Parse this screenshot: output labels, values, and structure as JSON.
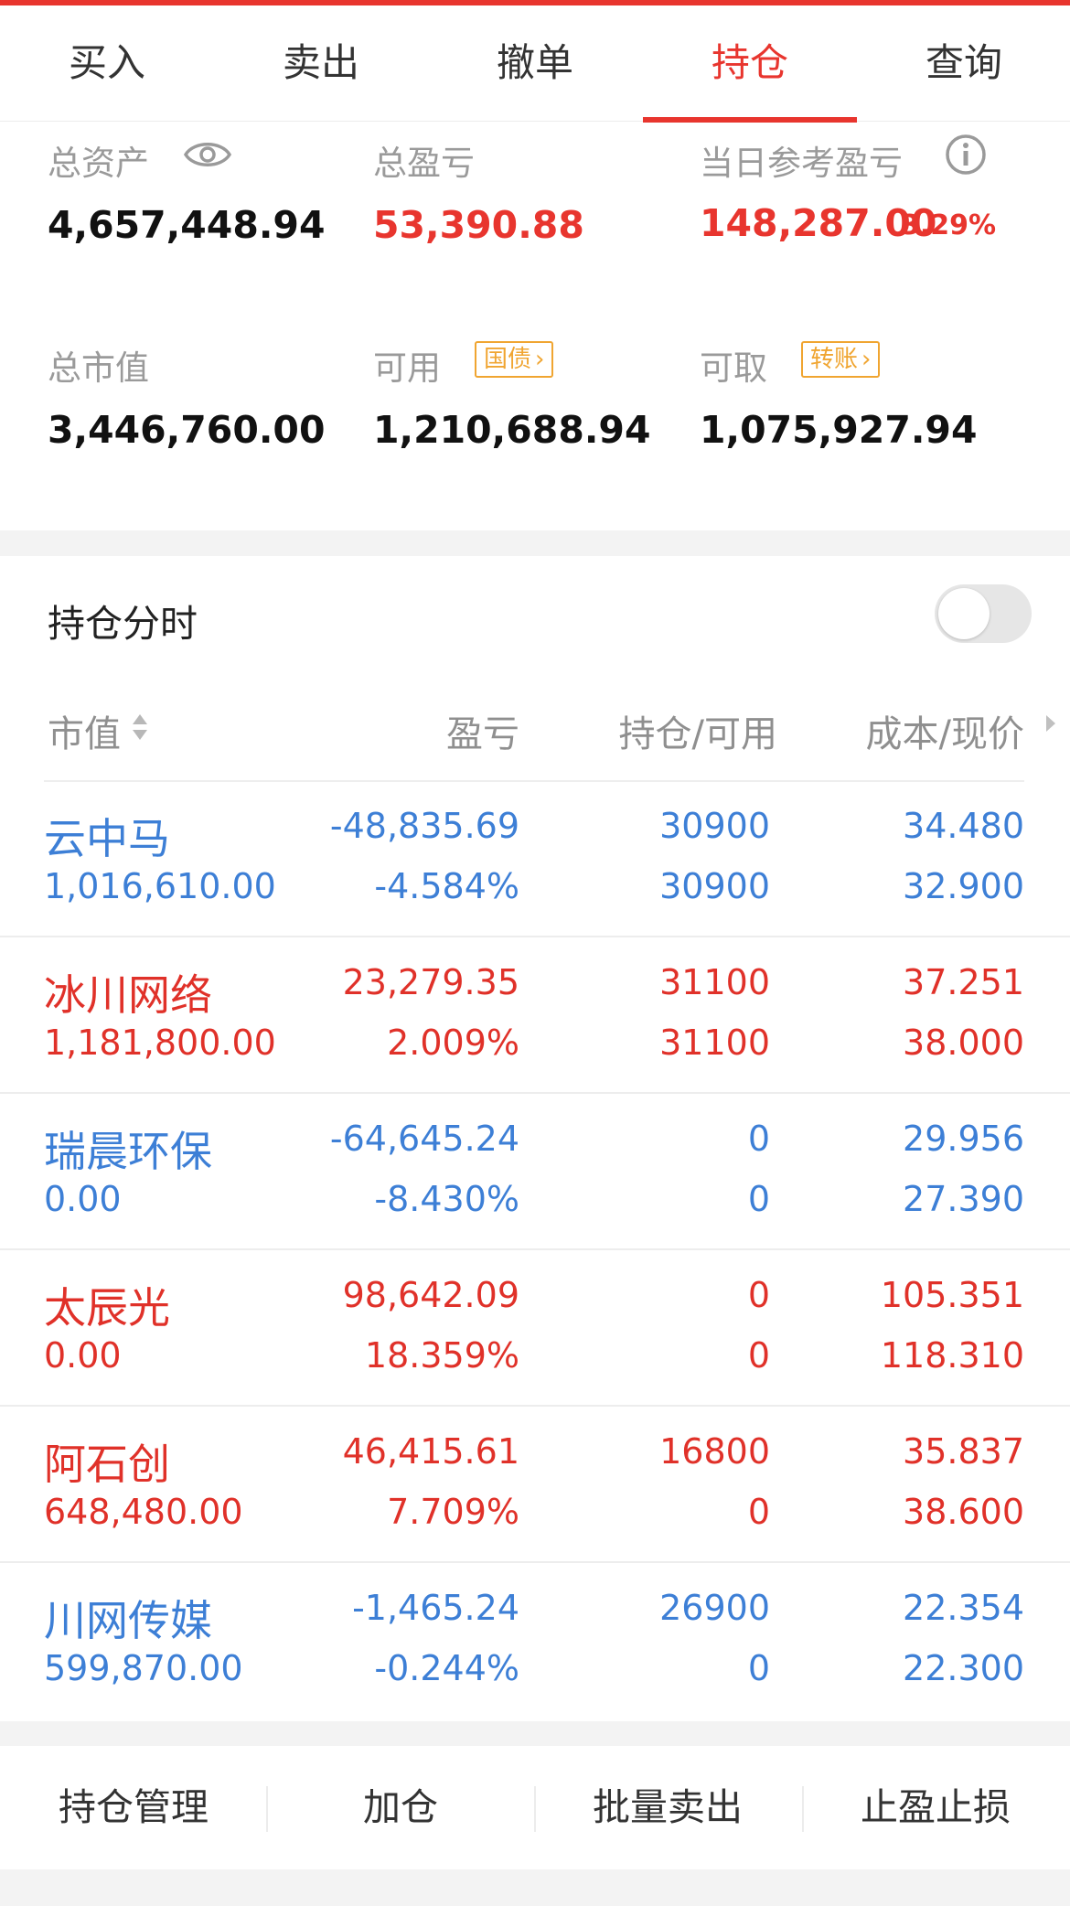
{
  "tabs": [
    {
      "label": "买入"
    },
    {
      "label": "卖出"
    },
    {
      "label": "撤单"
    },
    {
      "label": "持仓"
    },
    {
      "label": "查询"
    }
  ],
  "summary": {
    "total_assets_label": "总资产",
    "total_assets": "4,657,448.94",
    "total_pl_label": "总盈亏",
    "total_pl": "53,390.88",
    "daily_pl_label": "当日参考盈亏",
    "daily_pl": "148,287.00",
    "daily_pl_pct": "3.29%",
    "market_value_label": "总市值",
    "market_value": "3,446,760.00",
    "available_label": "可用",
    "available_tag": "国债",
    "available": "1,210,688.94",
    "withdrawable_label": "可取",
    "withdrawable_tag": "转账",
    "withdrawable": "1,075,927.94"
  },
  "holdings": {
    "title": "持仓分时",
    "toggle_on": false,
    "columns": [
      "市值",
      "盈亏",
      "持仓/可用",
      "成本/现价"
    ],
    "rows": [
      {
        "name": "云中马",
        "market_value": "1,016,610.00",
        "pl": "-48,835.69",
        "pl_pct": "-4.584%",
        "position": "30900",
        "available": "30900",
        "cost": "34.480",
        "price": "32.900",
        "color": "blue"
      },
      {
        "name": "冰川网络",
        "market_value": "1,181,800.00",
        "pl": "23,279.35",
        "pl_pct": "2.009%",
        "position": "31100",
        "available": "31100",
        "cost": "37.251",
        "price": "38.000",
        "color": "red"
      },
      {
        "name": "瑞晨环保",
        "market_value": "0.00",
        "pl": "-64,645.24",
        "pl_pct": "-8.430%",
        "position": "0",
        "available": "0",
        "cost": "29.956",
        "price": "27.390",
        "color": "blue"
      },
      {
        "name": "太辰光",
        "market_value": "0.00",
        "pl": "98,642.09",
        "pl_pct": "18.359%",
        "position": "0",
        "available": "0",
        "cost": "105.351",
        "price": "118.310",
        "color": "red"
      },
      {
        "name": "阿石创",
        "market_value": "648,480.00",
        "pl": "46,415.61",
        "pl_pct": "7.709%",
        "position": "16800",
        "available": "0",
        "cost": "35.837",
        "price": "38.600",
        "color": "red"
      },
      {
        "name": "川网传媒",
        "market_value": "599,870.00",
        "pl": "-1,465.24",
        "pl_pct": "-0.244%",
        "position": "26900",
        "available": "0",
        "cost": "22.354",
        "price": "22.300",
        "color": "blue"
      }
    ]
  },
  "bottom_actions": [
    {
      "label": "持仓管理"
    },
    {
      "label": "加仓"
    },
    {
      "label": "批量卖出"
    },
    {
      "label": "止盈止损"
    }
  ],
  "colors": {
    "accent_red": "#e8352e",
    "loss_blue": "#3d7fd6",
    "tag_orange": "#f0a531"
  },
  "icons": [
    "eye-icon",
    "info-icon",
    "sort-icon",
    "chevron-right-icon"
  ]
}
